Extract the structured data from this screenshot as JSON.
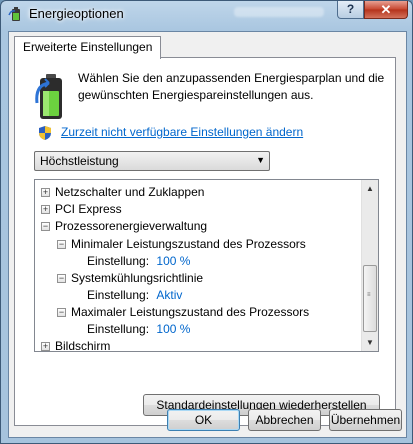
{
  "window": {
    "title": "Energieoptionen",
    "help_label": "?",
    "close_label": "✕"
  },
  "tab": {
    "label": "Erweiterte Einstellungen"
  },
  "intro": {
    "text": "Wählen Sie den anzupassenden Energiesparplan und die gewünschten Energiespareinstellungen aus.",
    "icon": "battery-icon"
  },
  "link": {
    "label": "Zurzeit nicht verfügbare Einstellungen ändern",
    "icon": "shield-icon"
  },
  "plan_select": {
    "value": "Höchstleistung",
    "icon": "chevron-down-icon"
  },
  "tree": {
    "items": [
      {
        "label": "Netzschalter und Zuklappen",
        "expander": "+"
      },
      {
        "label": "PCI Express",
        "expander": "+"
      },
      {
        "label": "Prozessorenergieverwaltung",
        "expander": "−"
      },
      {
        "label": "Minimaler Leistungszustand des Prozessors",
        "expander": "−"
      },
      {
        "label": "Einstellung:",
        "value": "100 %"
      },
      {
        "label": "Systemkühlungsrichtlinie",
        "expander": "−"
      },
      {
        "label": "Einstellung:",
        "value": "Aktiv"
      },
      {
        "label": "Maximaler Leistungszustand des Prozessors",
        "expander": "−"
      },
      {
        "label": "Einstellung:",
        "value": "100 %"
      },
      {
        "label": "Bildschirm",
        "expander": "+"
      }
    ],
    "scrollbar": {
      "up": "▲",
      "down": "▼",
      "grip": "≡"
    }
  },
  "buttons": {
    "restore": "Standardeinstellungen wiederherstellen",
    "ok": "OK",
    "cancel": "Abbrechen",
    "apply": "Übernehmen"
  },
  "colors": {
    "link": "#0066cc",
    "value": "#0066cc",
    "close": "#c7452e"
  }
}
